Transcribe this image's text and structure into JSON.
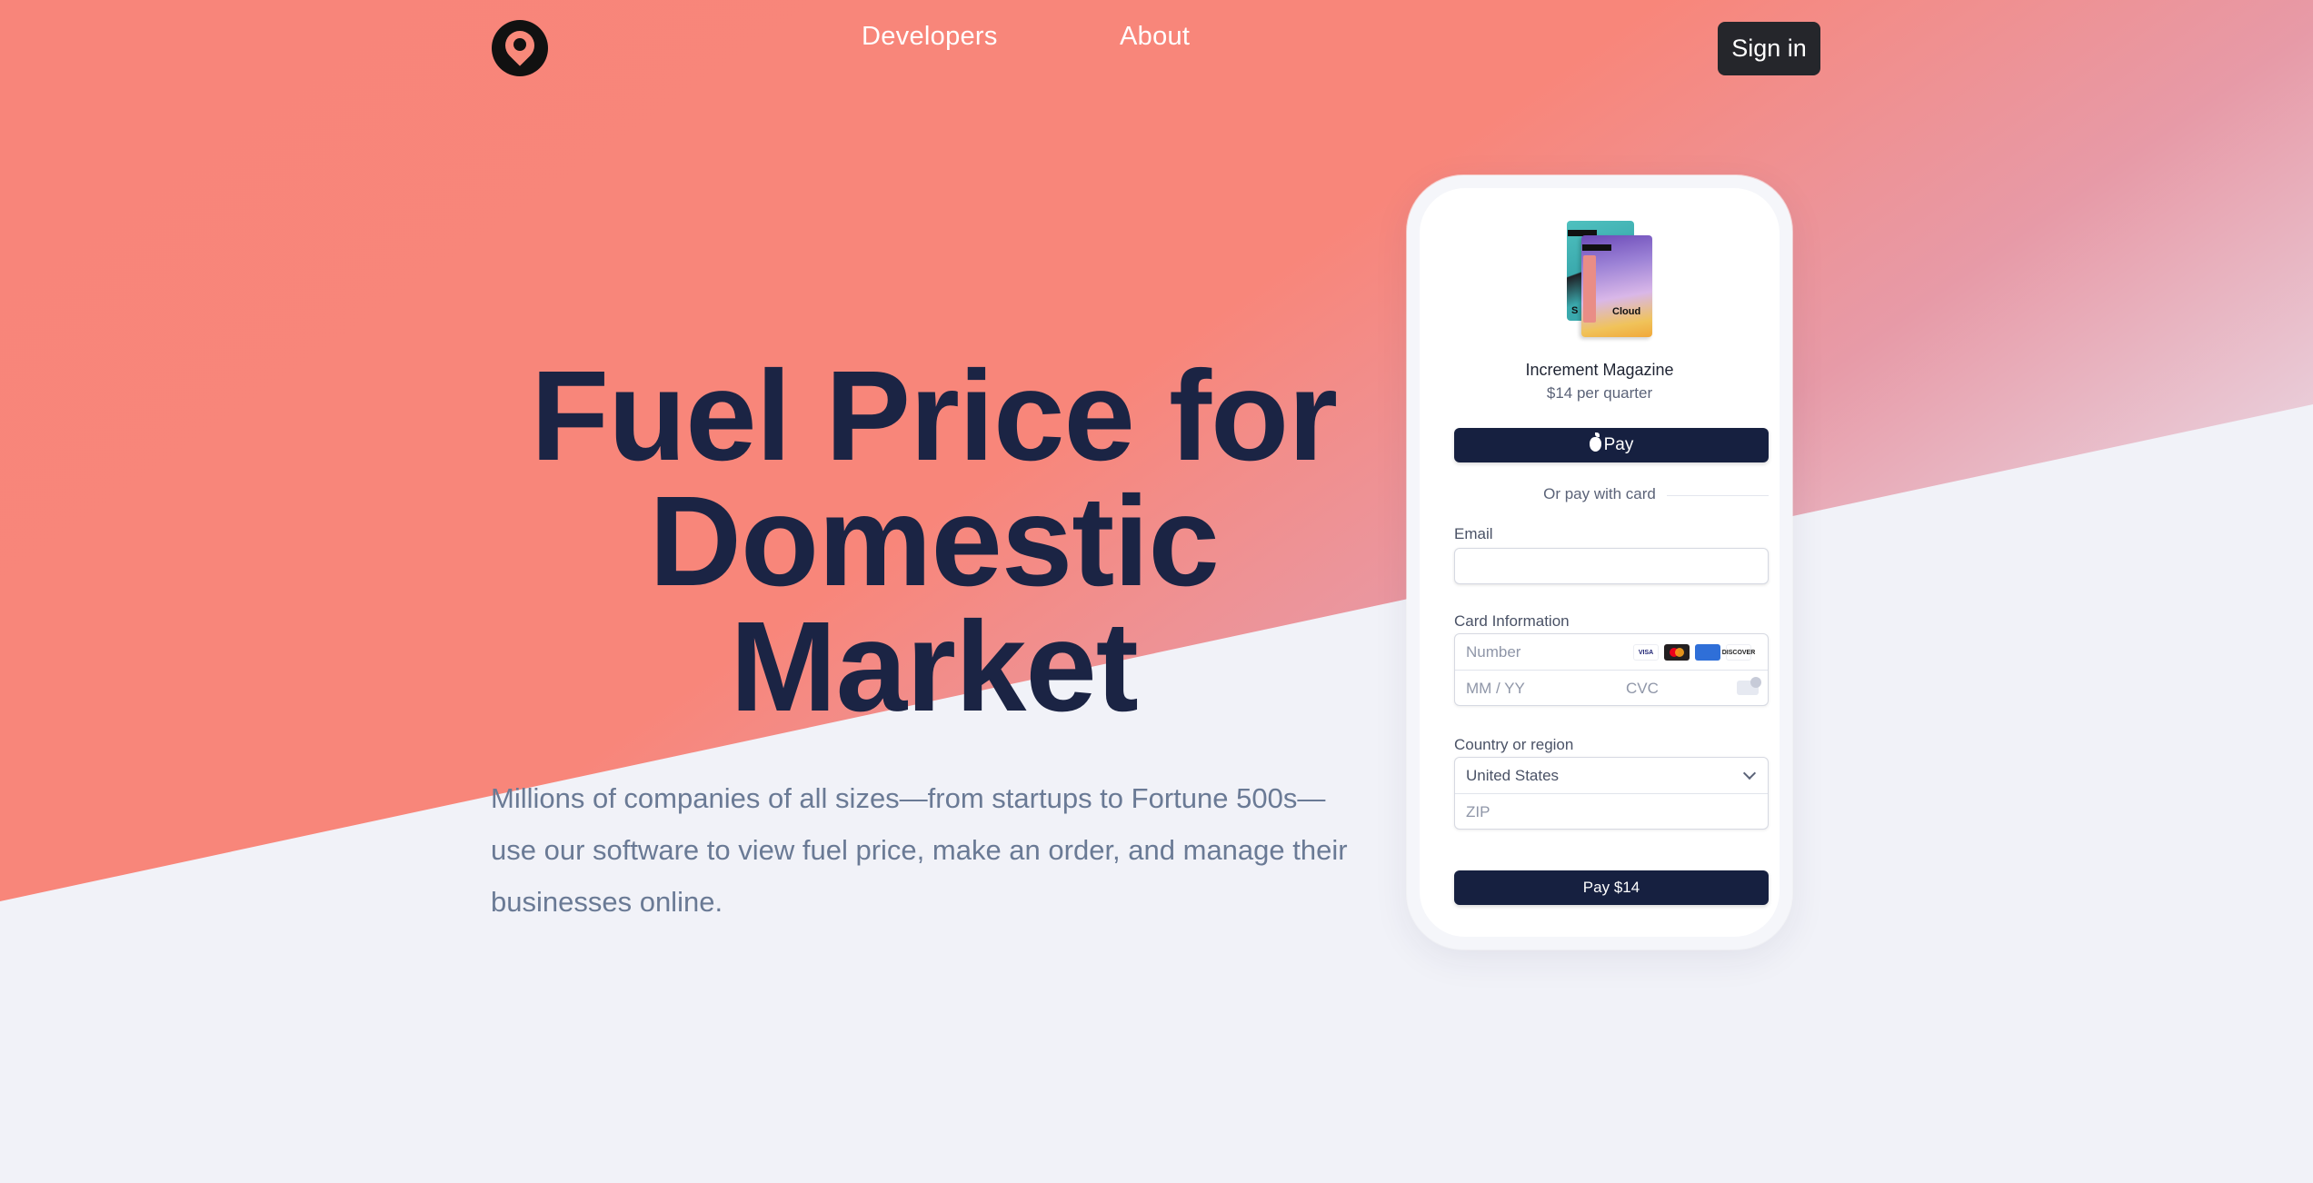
{
  "nav": {
    "links": [
      {
        "label": "Developers"
      },
      {
        "label": "About"
      }
    ],
    "signin_label": "Sign in"
  },
  "hero": {
    "headline_lines": [
      "Fuel Price for",
      "Domestic",
      "Market"
    ],
    "subcopy": "Millions of companies of all sizes—from startups to Fortune 500s—use our software to view fuel price, make an order, and manage their businesses online."
  },
  "checkout": {
    "product_art_texts": [
      "Cloud",
      "S"
    ],
    "product_name": "Increment Magazine",
    "product_price": "$14 per quarter",
    "applepay_label": "Pay",
    "divider_text": "Or pay with card",
    "email_label": "Email",
    "email_value": "",
    "card_label": "Card Information",
    "card_number_placeholder": "Number",
    "card_expiry_placeholder": "MM / YY",
    "card_cvc_placeholder": "CVC",
    "card_brands": [
      "VISA",
      "",
      "",
      "DISCOVER"
    ],
    "country_label": "Country or region",
    "country_value": "United States",
    "zip_placeholder": "ZIP",
    "pay_label": "Pay $14"
  },
  "colors": {
    "hero_coral": "#f8897a",
    "hero_pink": "#e7a5b6",
    "page_bg": "#f1f2f8",
    "headline": "#1b2444",
    "subcopy": "#6a7a95",
    "button_dark": "#162040",
    "signin_bg": "#25262b"
  },
  "icons": {
    "logo": "location-pin-icon",
    "apple": "apple-icon",
    "chevron": "chevron-down-icon",
    "cvc": "cvc-card-icon"
  }
}
